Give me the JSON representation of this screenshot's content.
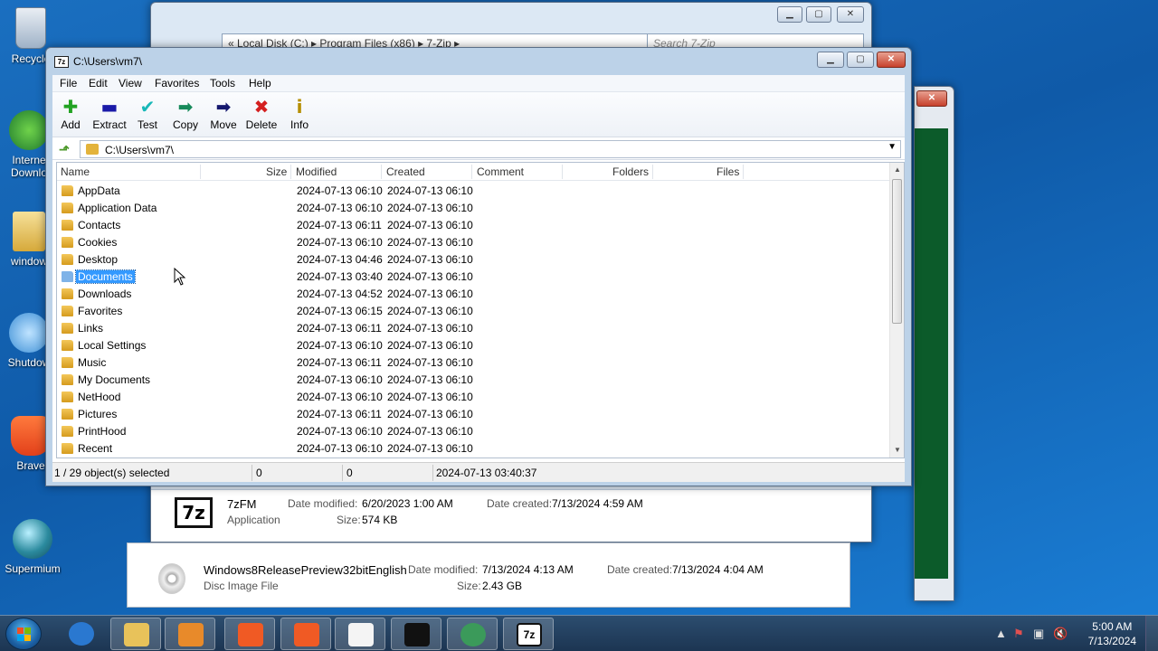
{
  "desktop_icons": [
    {
      "label": "Recycle",
      "icon": "recycle-bin-icon"
    },
    {
      "label": "Interne Downlo",
      "icon": "download-manager-icon"
    },
    {
      "label": "window",
      "icon": "folder-icon"
    },
    {
      "label": "Shutdow",
      "icon": "power-icon"
    },
    {
      "label": "Brave",
      "icon": "brave-lion-icon"
    },
    {
      "label": "Supermium",
      "icon": "browser-globe-icon"
    }
  ],
  "bg_explorer": {
    "address": "«  Local Disk (C:)  ▸  Program Files (x86)  ▸  7-Zip  ▸",
    "search_placeholder": "Search 7-Zip",
    "file": {
      "icon_text": "7z",
      "name": "7zFM",
      "type": "Application",
      "modified_label": "Date modified:",
      "modified": "6/20/2023 1:00 AM",
      "created_label": "Date created:",
      "created": "7/13/2024 4:59 AM",
      "size_label": "Size:",
      "size": "574 KB"
    }
  },
  "bg_explorer2": {
    "file": {
      "name": "Windows8ReleasePreview32bitEnglish",
      "type": "Disc Image File",
      "modified_label": "Date modified:",
      "modified": "7/13/2024 4:13 AM",
      "created_label": "Date created:",
      "created": "7/13/2024 4:04 AM",
      "size_label": "Size:",
      "size": "2.43 GB"
    }
  },
  "sevenzip": {
    "title": "C:\\Users\\vm7\\",
    "title_icon": "7z",
    "menu": [
      "File",
      "Edit",
      "View",
      "Favorites",
      "Tools",
      "Help"
    ],
    "toolbar": [
      {
        "label": "Add",
        "glyph": "✚",
        "color": "#22a322",
        "icon": "add-icon"
      },
      {
        "label": "Extract",
        "glyph": "▬",
        "color": "#1a1aa8",
        "icon": "extract-icon"
      },
      {
        "label": "Test",
        "glyph": "✔",
        "color": "#18b8b8",
        "icon": "test-icon"
      },
      {
        "label": "Copy",
        "glyph": "➡",
        "color": "#178a5a",
        "icon": "copy-icon"
      },
      {
        "label": "Move",
        "glyph": "➡",
        "color": "#15186e",
        "icon": "move-icon"
      },
      {
        "label": "Delete",
        "glyph": "✖",
        "color": "#d42020",
        "icon": "delete-icon"
      },
      {
        "label": "Info",
        "glyph": "i",
        "color": "#b58e00",
        "icon": "info-icon"
      }
    ],
    "path": "C:\\Users\\vm7\\",
    "columns": [
      "Name",
      "Size",
      "Modified",
      "Created",
      "Comment",
      "Folders",
      "Files"
    ],
    "rows": [
      {
        "name": "AppData",
        "modified": "2024-07-13 06:10",
        "created": "2024-07-13 06:10"
      },
      {
        "name": "Application Data",
        "modified": "2024-07-13 06:10",
        "created": "2024-07-13 06:10"
      },
      {
        "name": "Contacts",
        "modified": "2024-07-13 06:11",
        "created": "2024-07-13 06:10"
      },
      {
        "name": "Cookies",
        "modified": "2024-07-13 06:10",
        "created": "2024-07-13 06:10"
      },
      {
        "name": "Desktop",
        "modified": "2024-07-13 04:46",
        "created": "2024-07-13 06:10"
      },
      {
        "name": "Documents",
        "modified": "2024-07-13 03:40",
        "created": "2024-07-13 06:10",
        "selected": true
      },
      {
        "name": "Downloads",
        "modified": "2024-07-13 04:52",
        "created": "2024-07-13 06:10"
      },
      {
        "name": "Favorites",
        "modified": "2024-07-13 06:15",
        "created": "2024-07-13 06:10"
      },
      {
        "name": "Links",
        "modified": "2024-07-13 06:11",
        "created": "2024-07-13 06:10"
      },
      {
        "name": "Local Settings",
        "modified": "2024-07-13 06:10",
        "created": "2024-07-13 06:10"
      },
      {
        "name": "Music",
        "modified": "2024-07-13 06:11",
        "created": "2024-07-13 06:10"
      },
      {
        "name": "My Documents",
        "modified": "2024-07-13 06:10",
        "created": "2024-07-13 06:10"
      },
      {
        "name": "NetHood",
        "modified": "2024-07-13 06:10",
        "created": "2024-07-13 06:10"
      },
      {
        "name": "Pictures",
        "modified": "2024-07-13 06:11",
        "created": "2024-07-13 06:10"
      },
      {
        "name": "PrintHood",
        "modified": "2024-07-13 06:10",
        "created": "2024-07-13 06:10"
      },
      {
        "name": "Recent",
        "modified": "2024-07-13 06:10",
        "created": "2024-07-13 06:10"
      }
    ],
    "status": {
      "selection": "1 / 29 object(s) selected",
      "size": "0",
      "packed": "0",
      "modified": "2024-07-13 03:40:37"
    }
  },
  "taskbar": {
    "apps": [
      {
        "icon": "internet-explorer-icon",
        "color": "#2a78d0"
      },
      {
        "icon": "file-explorer-icon",
        "color": "#e8c25a"
      },
      {
        "icon": "media-player-icon",
        "color": "#e88a2a"
      },
      {
        "icon": "brave-icon",
        "color": "#f05a24"
      },
      {
        "icon": "brave-icon",
        "color": "#f05a24"
      },
      {
        "icon": "solitaire-icon",
        "color": "#f4f4f4"
      },
      {
        "icon": "command-prompt-icon",
        "color": "#111111"
      },
      {
        "icon": "supermium-icon",
        "color": "#3b9a5a"
      },
      {
        "icon": "7zip-icon",
        "color": "#ffffff"
      }
    ],
    "time": "5:00 AM",
    "date": "7/13/2024"
  }
}
